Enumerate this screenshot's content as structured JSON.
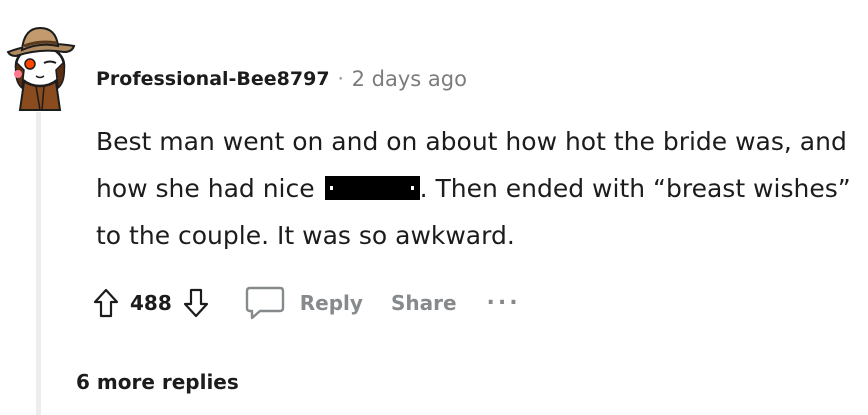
{
  "comment": {
    "author": "Professional-Bee8797",
    "separator": "·",
    "timestamp": "2 days ago",
    "body_part1": "Best man went on and on about how hot the bride was, and how she had nice ",
    "body_part2": ". Then ended with “breast wishes” to the couple. It was so awkward.",
    "score": "488",
    "reply_label": "Reply",
    "share_label": "Share",
    "more_label": "...",
    "more_replies": "6 more replies"
  },
  "icons": {
    "avatar": "snoo-avatar-cowboy-hat",
    "upvote": "upvote-arrow-icon",
    "downvote": "downvote-arrow-icon",
    "reply": "speech-bubble-icon",
    "more": "ellipsis-icon"
  },
  "colors": {
    "text": "#1c1c1c",
    "muted": "#878a8c",
    "thread_line": "#ededed"
  }
}
